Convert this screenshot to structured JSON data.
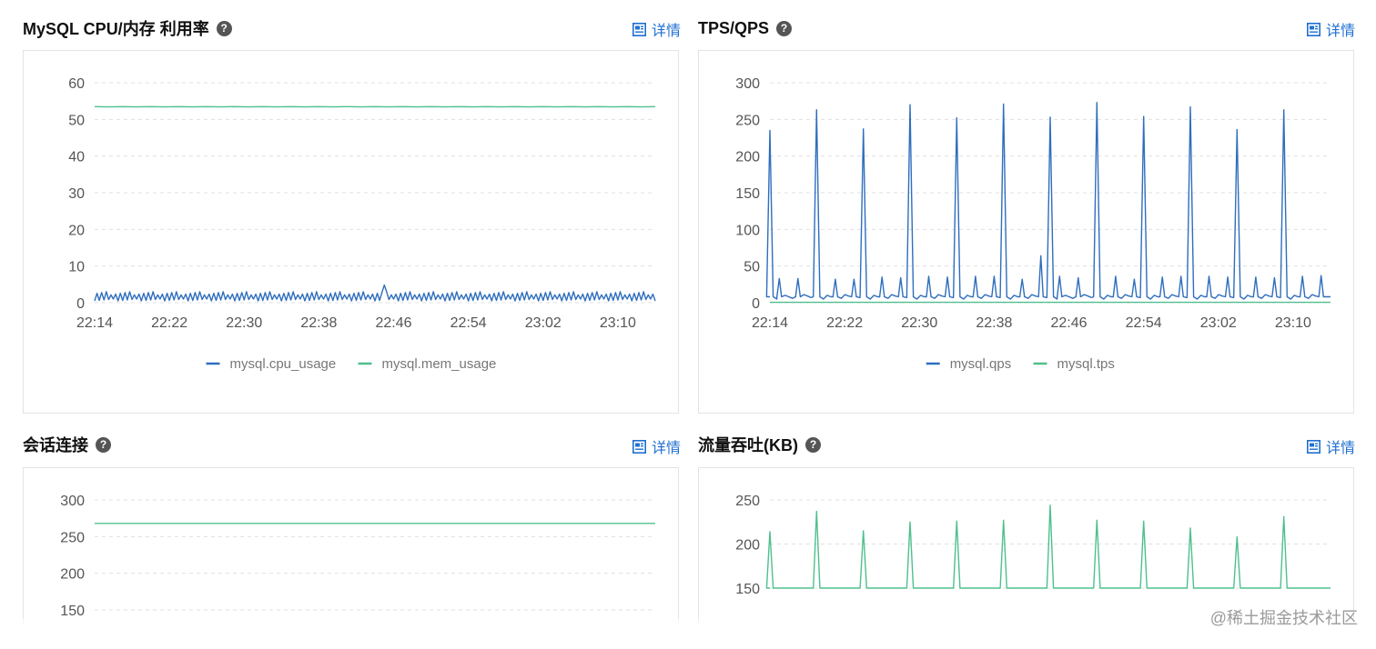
{
  "panels": [
    {
      "title": "MySQL CPU/内存 利用率",
      "help": "?",
      "detail": "详情"
    },
    {
      "title": "TPS/QPS",
      "help": "?",
      "detail": "详情"
    },
    {
      "title": "会话连接",
      "help": "?",
      "detail": "详情"
    },
    {
      "title": "流量吞吐(KB)",
      "help": "?",
      "detail": "详情"
    }
  ],
  "watermark": "@稀土掘金技术社区",
  "colors": {
    "blue": "#2f6ebd",
    "green": "#4fbf8e",
    "link": "#1f6fd1",
    "grid": "#e0e0e0"
  },
  "icons": {
    "help": "question-circle-icon",
    "detail": "report-icon"
  },
  "chart_data": [
    {
      "type": "line",
      "title": "MySQL CPU/内存 利用率",
      "x_ticks": [
        "22:14",
        "22:22",
        "22:30",
        "22:38",
        "22:46",
        "22:54",
        "23:02",
        "23:10"
      ],
      "x_range": [
        "22:14",
        "23:14"
      ],
      "ylim": [
        0,
        60
      ],
      "y_ticks": [
        0,
        10,
        20,
        30,
        40,
        50,
        60
      ],
      "grid": true,
      "legend": "bottom-center",
      "series": [
        {
          "name": "mysql.cpu_usage",
          "color": "#2f6ebd",
          "pattern": "oscillating",
          "low": 0.5,
          "high": 3.0,
          "peaks": [
            {
              "x": "22:45",
              "y": 4.8
            }
          ]
        },
        {
          "name": "mysql.mem_usage",
          "color": "#4fbf8e",
          "pattern": "flat",
          "value": 53.4
        }
      ]
    },
    {
      "type": "line",
      "title": "TPS/QPS",
      "x_ticks": [
        "22:14",
        "22:22",
        "22:30",
        "22:38",
        "22:46",
        "22:54",
        "23:02",
        "23:10"
      ],
      "x_range": [
        "22:14",
        "23:14"
      ],
      "ylim": [
        0,
        300
      ],
      "y_ticks": [
        0,
        50,
        100,
        150,
        200,
        250,
        300
      ],
      "grid": true,
      "legend": "bottom-center",
      "series": [
        {
          "name": "mysql.qps",
          "color": "#2f6ebd",
          "pattern": "spikes",
          "baseline": 8,
          "spikes": [
            {
              "x": "22:14",
              "y": 235
            },
            {
              "x": "22:19",
              "y": 263
            },
            {
              "x": "22:24",
              "y": 237
            },
            {
              "x": "22:29",
              "y": 270
            },
            {
              "x": "22:34",
              "y": 252
            },
            {
              "x": "22:39",
              "y": 271
            },
            {
              "x": "22:44",
              "y": 253
            },
            {
              "x": "22:49",
              "y": 273
            },
            {
              "x": "22:54",
              "y": 254
            },
            {
              "x": "22:59",
              "y": 267
            },
            {
              "x": "23:04",
              "y": 236
            },
            {
              "x": "23:09",
              "y": 263
            }
          ],
          "small_peaks": [
            {
              "x": "22:15",
              "y": 33
            },
            {
              "x": "22:17",
              "y": 33
            },
            {
              "x": "22:21",
              "y": 32
            },
            {
              "x": "22:23",
              "y": 32
            },
            {
              "x": "22:26",
              "y": 35
            },
            {
              "x": "22:28",
              "y": 34
            },
            {
              "x": "22:31",
              "y": 36
            },
            {
              "x": "22:33",
              "y": 35
            },
            {
              "x": "22:36",
              "y": 36
            },
            {
              "x": "22:38",
              "y": 36
            },
            {
              "x": "22:41",
              "y": 32
            },
            {
              "x": "22:43",
              "y": 64
            },
            {
              "x": "22:45",
              "y": 36
            },
            {
              "x": "22:47",
              "y": 34
            },
            {
              "x": "22:51",
              "y": 36
            },
            {
              "x": "22:53",
              "y": 32
            },
            {
              "x": "22:56",
              "y": 35
            },
            {
              "x": "22:58",
              "y": 36
            },
            {
              "x": "23:01",
              "y": 36
            },
            {
              "x": "23:03",
              "y": 35
            },
            {
              "x": "23:06",
              "y": 35
            },
            {
              "x": "23:08",
              "y": 34
            },
            {
              "x": "23:11",
              "y": 36
            },
            {
              "x": "23:13",
              "y": 37
            }
          ]
        },
        {
          "name": "mysql.tps",
          "color": "#4fbf8e",
          "pattern": "flat",
          "value": 0.5
        }
      ]
    },
    {
      "type": "line",
      "title": "会话连接",
      "x_range": [
        "22:14",
        "23:14"
      ],
      "ylim": [
        150,
        300
      ],
      "y_ticks": [
        150,
        200,
        250,
        300
      ],
      "grid": true,
      "series": [
        {
          "name": "",
          "color": "#4fbf8e",
          "pattern": "flat",
          "value": 268
        }
      ]
    },
    {
      "type": "line",
      "title": "流量吞吐(KB)",
      "x_range": [
        "22:14",
        "23:14"
      ],
      "ylim": [
        150,
        250
      ],
      "y_ticks": [
        150,
        200,
        250
      ],
      "grid": true,
      "series": [
        {
          "name": "",
          "color": "#4fbf8e",
          "pattern": "spikes",
          "spikes": [
            {
              "x": "22:14",
              "y": 214
            },
            {
              "x": "22:19",
              "y": 237
            },
            {
              "x": "22:24",
              "y": 215
            },
            {
              "x": "22:29",
              "y": 225
            },
            {
              "x": "22:34",
              "y": 226
            },
            {
              "x": "22:39",
              "y": 227
            },
            {
              "x": "22:44",
              "y": 244
            },
            {
              "x": "22:49",
              "y": 227
            },
            {
              "x": "22:54",
              "y": 226
            },
            {
              "x": "22:59",
              "y": 218
            },
            {
              "x": "23:04",
              "y": 208
            },
            {
              "x": "23:09",
              "y": 231
            }
          ]
        }
      ]
    }
  ]
}
